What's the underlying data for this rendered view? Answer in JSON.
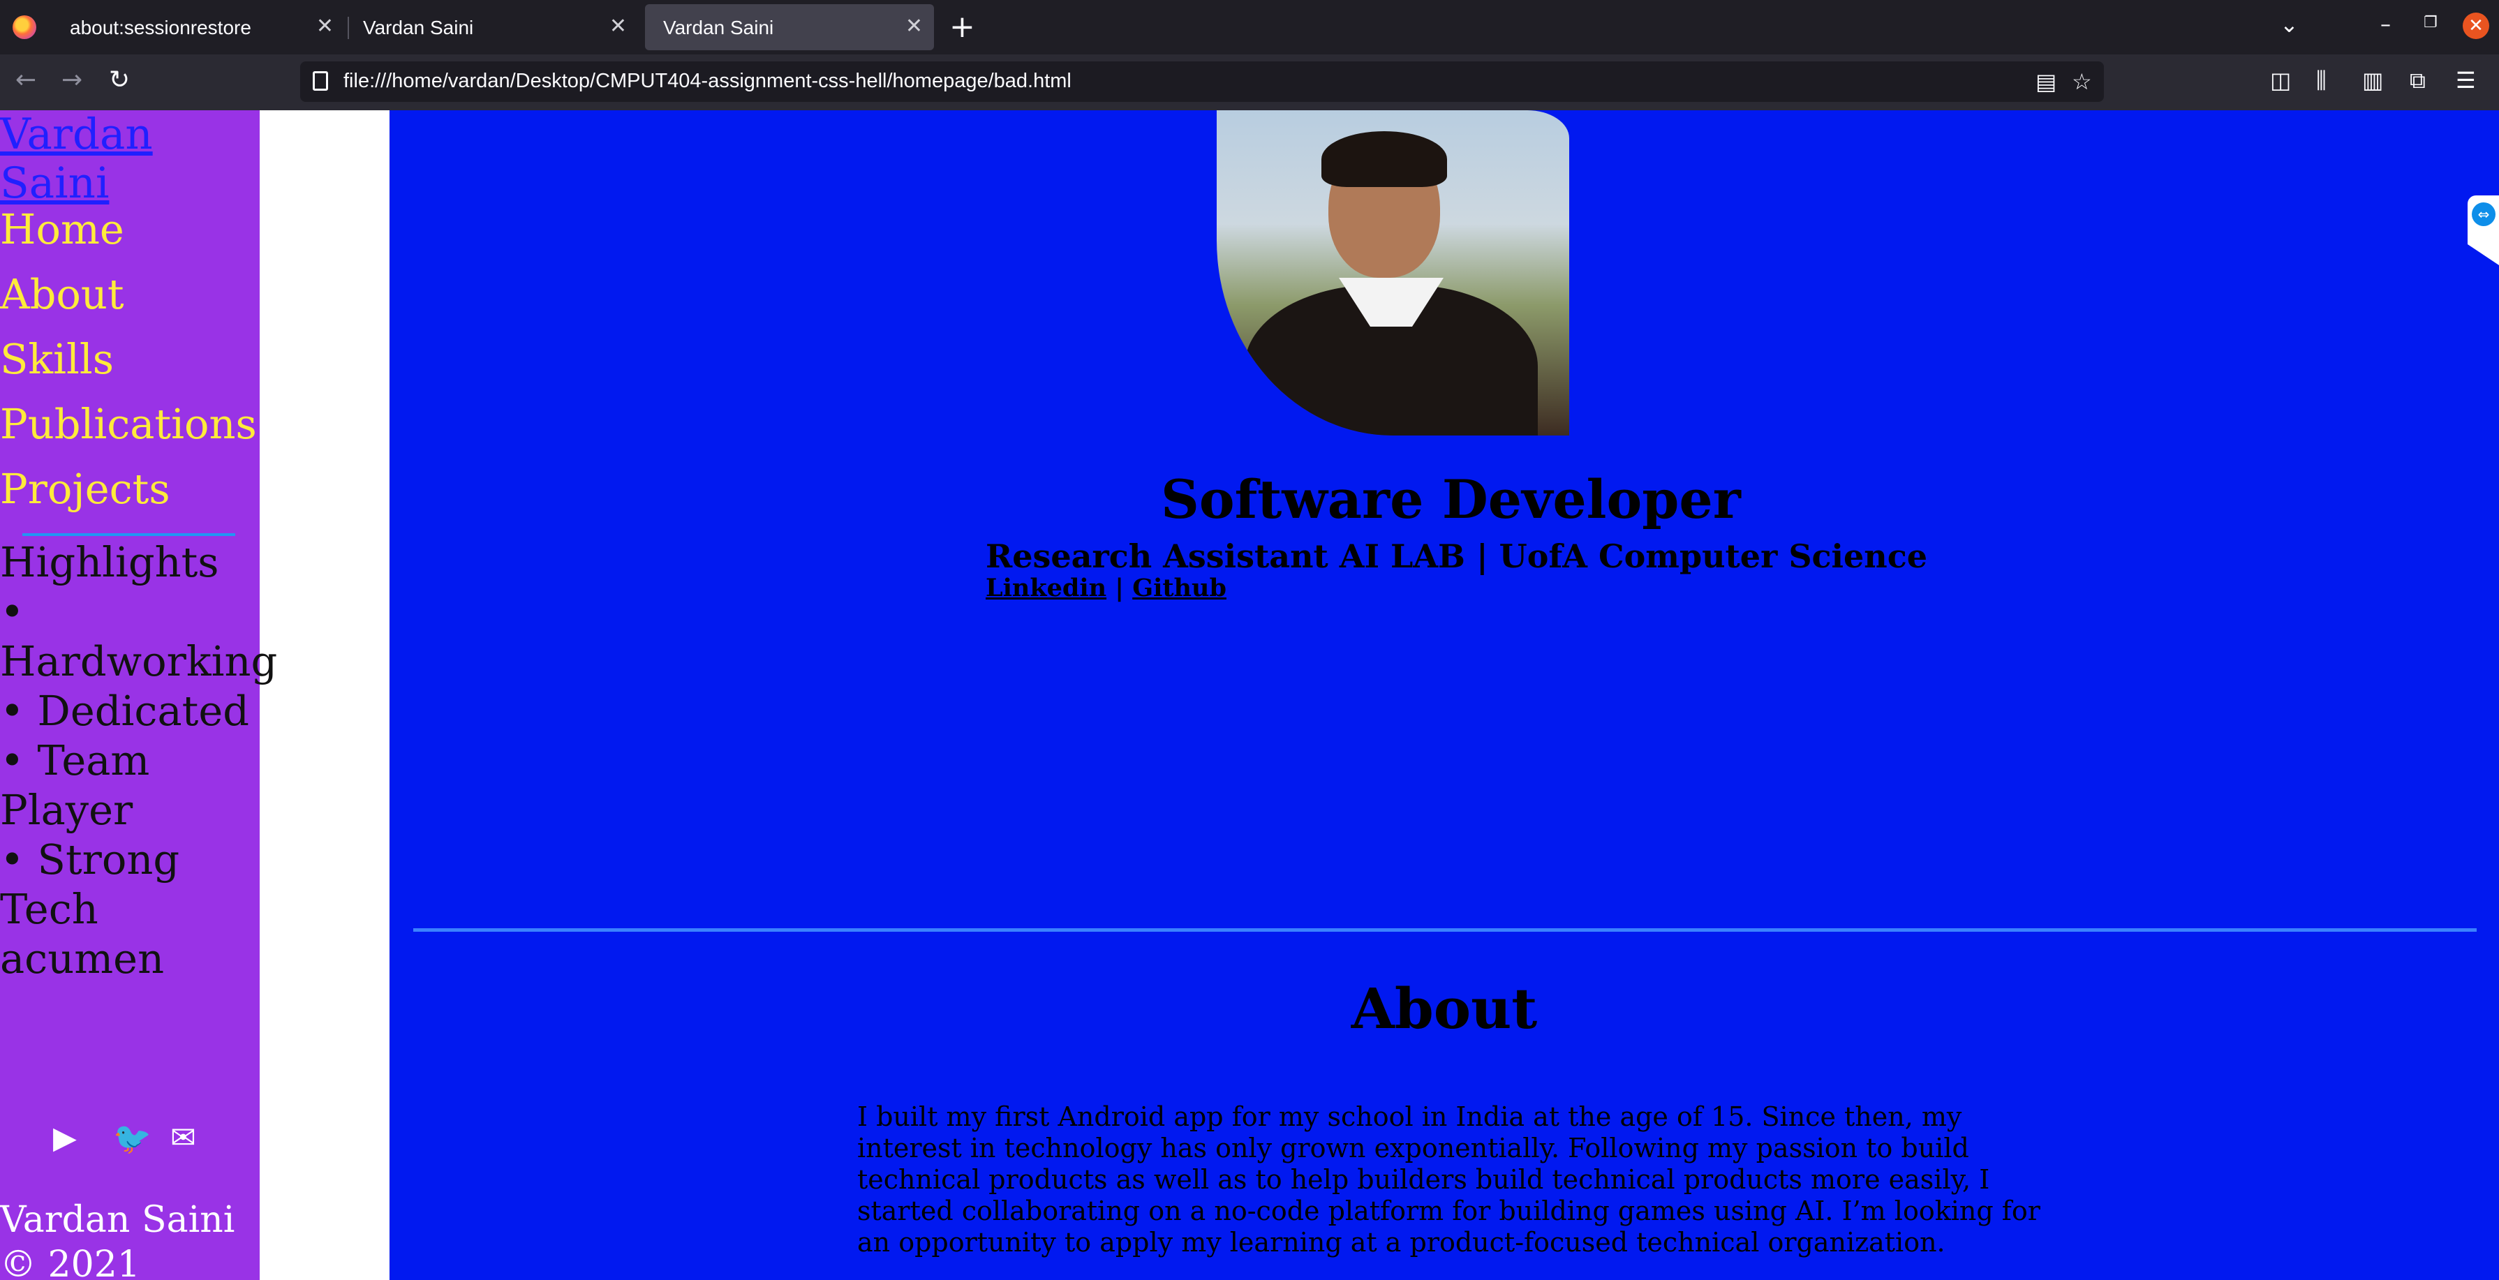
{
  "browser": {
    "tabs": [
      {
        "label": "about:sessionrestore",
        "active": false
      },
      {
        "label": "Vardan Saini",
        "active": false
      },
      {
        "label": "Vardan Saini",
        "active": true
      }
    ],
    "new_tab_icon": "plus-icon",
    "url": "file:///home/vardan/Desktop/CMPUT404-assignment-css-hell/homepage/bad.html",
    "window_controls": [
      "minimize-icon",
      "restore-icon",
      "close-icon"
    ]
  },
  "sidebar": {
    "brand": "Vardan Saini",
    "nav": [
      "Home",
      "About",
      "Skills",
      "Publications",
      "Projects"
    ],
    "highlights_title": "Highlights",
    "highlights": [
      "• Hardworking",
      "• Dedicated",
      "• Team Player",
      "• Strong Tech acumen"
    ],
    "social_icons": [
      "youtube-icon",
      "twitter-icon",
      "email-icon"
    ],
    "footer_name": "Vardan Saini",
    "footer_copy": "© 2021"
  },
  "hero": {
    "title": "Software Developer",
    "subtitle": "Research Assistant AI LAB | UofA Computer Science",
    "link_linkedin": "Linkedin",
    "link_separator": "|",
    "link_github": "Github"
  },
  "about": {
    "heading": "About",
    "text": "I built my first Android app for my school in India at the age of 15. Since then, my interest in technology has only grown exponentially. Following my passion to build technical products as well as to help builders build technical products more easily, I started collaborating on a no-code platform for building games using AI. I’m looking for an opportunity to apply my learning at a product-focused technical organization."
  },
  "colors": {
    "sidebar_bg": "#9933e6",
    "main_bg": "#0119f0",
    "nav_link": "#ffeb3b",
    "brand_link": "#2020ff",
    "divider": "#3b82ff"
  }
}
